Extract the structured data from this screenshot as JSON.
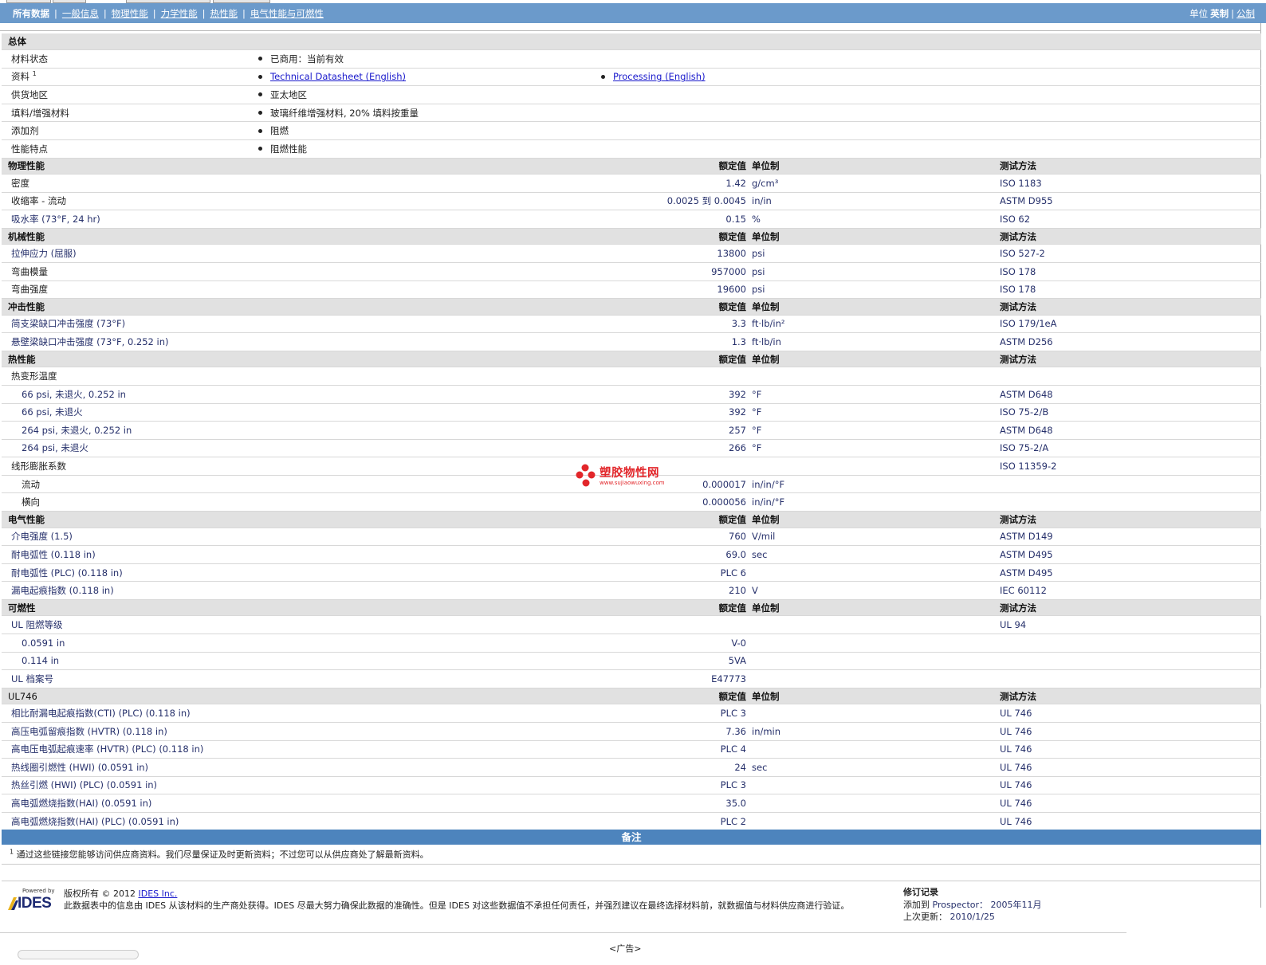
{
  "nav": {
    "items": [
      "所有数据",
      "一般信息",
      "物理性能",
      "力学性能",
      "热性能",
      "电气性能与可燃性"
    ],
    "units_label": "单位",
    "unit_selected": "英制",
    "unit_link": "公制"
  },
  "general": {
    "title": "总体",
    "rows": [
      {
        "name": "材料状态",
        "values": [
          "已商用：当前有效"
        ]
      },
      {
        "name": "资料",
        "sup": "1",
        "links": [
          "Technical Datasheet (English)",
          "Processing (English)"
        ]
      },
      {
        "name": "供货地区",
        "values": [
          "亚太地区"
        ]
      },
      {
        "name": "填料/增强材料",
        "values": [
          "玻璃纤维增强材料, 20% 填料按重量"
        ]
      },
      {
        "name": "添加剂",
        "values": [
          "阻燃"
        ]
      },
      {
        "name": "性能特点",
        "values": [
          "阻燃性能"
        ]
      }
    ]
  },
  "headers": {
    "nominal": "额定值",
    "unit": "单位制",
    "method": "测试方法"
  },
  "sections": [
    {
      "title": "物理性能",
      "rows": [
        {
          "name": "密度",
          "nominal": "1.42",
          "unit": "g/cm³",
          "method": "ISO 1183"
        },
        {
          "name": "收缩率 - 流动",
          "nominal": "0.0025 到 0.0045",
          "unit": "in/in",
          "method": "ASTM D955"
        },
        {
          "name": "吸水率 (73°F, 24 hr)",
          "nominal": "0.15",
          "unit": "%",
          "method": "ISO 62"
        }
      ]
    },
    {
      "title": "机械性能",
      "rows": [
        {
          "name": "拉伸应力 (屈服)",
          "nominal": "13800",
          "unit": "psi",
          "method": "ISO 527-2"
        },
        {
          "name": "弯曲模量",
          "nominal": "957000",
          "unit": "psi",
          "method": "ISO 178"
        },
        {
          "name": "弯曲强度",
          "nominal": "19600",
          "unit": "psi",
          "method": "ISO 178"
        }
      ]
    },
    {
      "title": "冲击性能",
      "rows": [
        {
          "name": "简支梁缺口冲击强度 (73°F)",
          "nominal": "3.3",
          "unit": "ft·lb/in²",
          "method": "ISO 179/1eA"
        },
        {
          "name": "悬壁梁缺口冲击强度 (73°F, 0.252 in)",
          "nominal": "1.3",
          "unit": "ft·lb/in",
          "method": "ASTM D256"
        }
      ]
    },
    {
      "title": "热性能",
      "rows": [
        {
          "name": "热变形温度",
          "nominal": "",
          "unit": "",
          "method": ""
        },
        {
          "name": "66 psi, 未退火, 0.252 in",
          "indent": true,
          "nominal": "392",
          "unit": "°F",
          "method": "ASTM D648"
        },
        {
          "name": "66 psi, 未退火",
          "indent": true,
          "nominal": "392",
          "unit": "°F",
          "method": "ISO 75-2/B"
        },
        {
          "name": "264 psi, 未退火, 0.252 in",
          "indent": true,
          "nominal": "257",
          "unit": "°F",
          "method": "ASTM D648"
        },
        {
          "name": "264 psi, 未退火",
          "indent": true,
          "nominal": "266",
          "unit": "°F",
          "method": "ISO 75-2/A"
        },
        {
          "name": "线形膨胀系数",
          "nominal": "",
          "unit": "",
          "method": "ISO 11359-2"
        },
        {
          "name": "流动",
          "indent": true,
          "nominal": "0.000017",
          "unit": "in/in/°F",
          "method": ""
        },
        {
          "name": "横向",
          "indent": true,
          "nominal": "0.000056",
          "unit": "in/in/°F",
          "method": ""
        }
      ]
    },
    {
      "title": "电气性能",
      "rows": [
        {
          "name": "介电强度 (1.5)",
          "nominal": "760",
          "unit": "V/mil",
          "method": "ASTM D149"
        },
        {
          "name": "耐电弧性 (0.118 in)",
          "nominal": "69.0",
          "unit": "sec",
          "method": "ASTM D495"
        },
        {
          "name": "耐电弧性 (PLC) (0.118 in)",
          "nominal": "PLC 6",
          "unit": "",
          "method": "ASTM D495"
        },
        {
          "name": "漏电起痕指数 (0.118 in)",
          "nominal": "210",
          "unit": "V",
          "method": "IEC 60112"
        }
      ]
    },
    {
      "title": "可燃性",
      "rows": [
        {
          "name": "UL 阻燃等级",
          "nominal": "",
          "unit": "",
          "method": "UL 94"
        },
        {
          "name": "0.0591 in",
          "indent": true,
          "nominal": "V-0",
          "unit": "",
          "method": ""
        },
        {
          "name": "0.114 in",
          "indent": true,
          "nominal": "5VA",
          "unit": "",
          "method": ""
        },
        {
          "name": "UL 档案号",
          "nominal": "E47773",
          "unit": "",
          "method": ""
        }
      ]
    },
    {
      "title": "UL746",
      "plain": true,
      "rows": [
        {
          "name": "相比耐漏电起痕指数(CTI) (PLC) (0.118 in)",
          "nominal": "PLC 3",
          "unit": "",
          "method": "UL 746"
        },
        {
          "name": "高压电弧留痕指数 (HVTR) (0.118 in)",
          "nominal": "7.36",
          "unit": "in/min",
          "method": "UL 746"
        },
        {
          "name": "高电压电弧起痕速率 (HVTR) (PLC) (0.118 in)",
          "nominal": "PLC 4",
          "unit": "",
          "method": "UL 746"
        },
        {
          "name": "热线圈引燃性 (HWI) (0.0591 in)",
          "nominal": "24",
          "unit": "sec",
          "method": "UL 746"
        },
        {
          "name": "热丝引燃 (HWI) (PLC) (0.0591 in)",
          "nominal": "PLC 3",
          "unit": "",
          "method": "UL 746"
        },
        {
          "name": "高电弧燃烧指数(HAI) (0.0591 in)",
          "nominal": "35.0",
          "unit": "",
          "method": "UL 746"
        },
        {
          "name": "高电弧燃烧指数(HAI) (PLC) (0.0591 in)",
          "nominal": "PLC 2",
          "unit": "",
          "method": "UL 746"
        }
      ]
    }
  ],
  "notes": {
    "title": "备注",
    "sup": "1",
    "text": "通过这些链接您能够访问供应商资料。我们尽量保证及时更新资料；不过您可以从供应商处了解最新资料。"
  },
  "footer": {
    "powered_by": "Powered by",
    "logo": "IDES",
    "copyright_prefix": "版权所有 © 2012",
    "copyright_link": "IDES Inc.",
    "disclaimer": "此数据表中的信息由 IDES 从该材料的生产商处获得。IDES 尽最大努力确保此数据的准确性。但是 IDES 对这些数据值不承担任何责任，并强烈建议在最终选择材料前，就数据值与材料供应商进行验证。",
    "revision_title": "修订记录",
    "added_label": "添加到",
    "added_target": "Prospector：",
    "added_date": "2005年11月",
    "updated_label": "上次更新：",
    "updated_date": "2010/1/25",
    "ad": "<广告>"
  },
  "watermark": {
    "text": "塑胶物性网",
    "url": "www.sujiaowuxing.com",
    "color": "#e2262a"
  }
}
